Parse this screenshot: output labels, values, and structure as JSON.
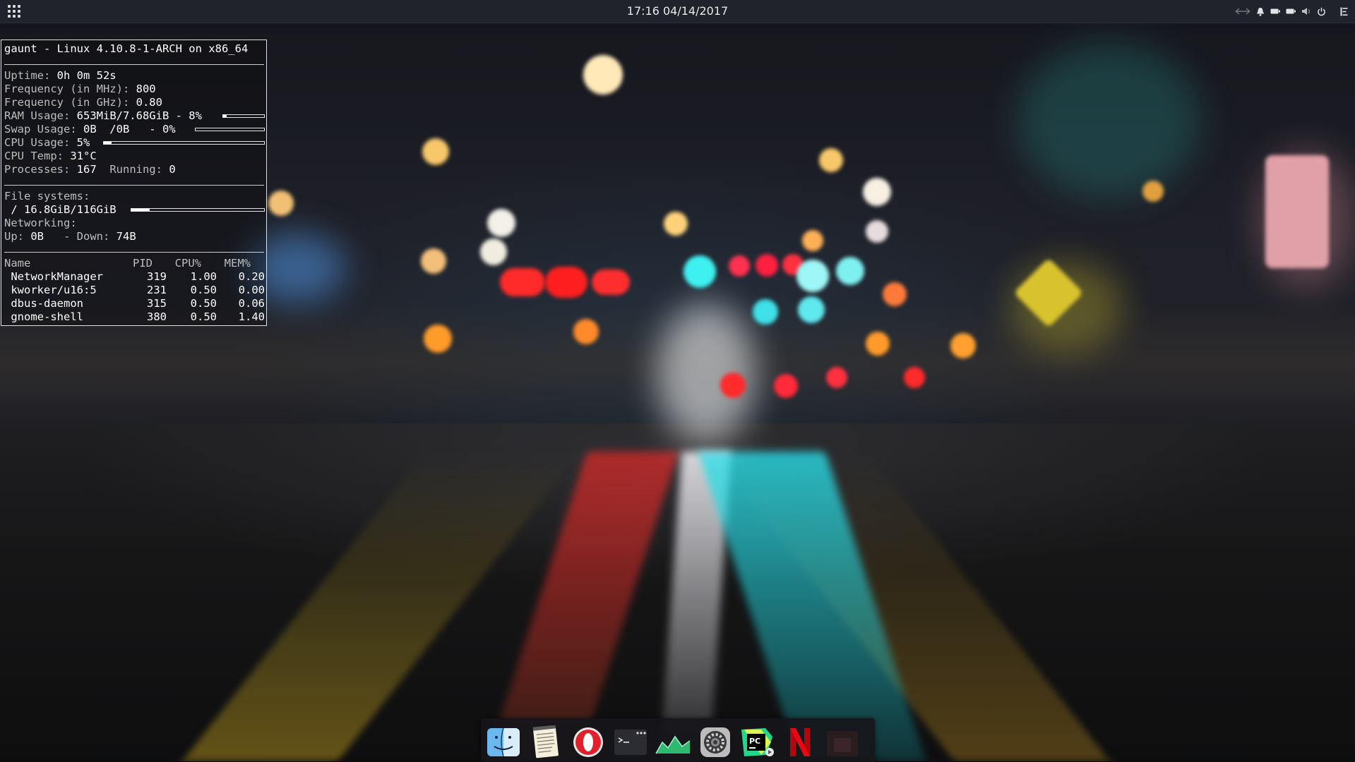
{
  "top_panel": {
    "apps_icon": "app-grid-icon",
    "clock": "17:16  04/14/2017",
    "tray_icons": [
      "network-icon",
      "notification-bell-icon",
      "battery-icon",
      "battery-icon",
      "volume-icon",
      "power-icon",
      "menu-icon"
    ]
  },
  "conky": {
    "title": "gaunt - Linux 4.10.8-1-ARCH on x86_64",
    "uptime_label": "Uptime: ",
    "uptime": "0h 0m 52s",
    "freq_mhz_label": "Frequency (in MHz): ",
    "freq_mhz": "800",
    "freq_ghz_label": "Frequency (in GHz): ",
    "freq_ghz": "0.80",
    "ram_label": "RAM Usage: ",
    "ram": "653MiB/7.68GiB - 8%",
    "ram_fraction": 0.08,
    "swap_label": "Swap Usage: ",
    "swap": "0B  /0B   - 0%",
    "swap_fraction": 0.0,
    "cpu_label": "CPU Usage: ",
    "cpu": "5%",
    "cpu_fraction": 0.05,
    "temp_label": "CPU Temp: ",
    "temp": "31°C",
    "processes_label": "Processes: ",
    "processes": "167",
    "running_label": "  Running: ",
    "running": "0",
    "fs_label": "File systems:",
    "fs_root": " / 16.8GiB/116GiB",
    "fs_fraction": 0.14,
    "net_label": "Networking:",
    "up_label": "Up: ",
    "up": "0B",
    "down_label": "   - Down: ",
    "down": "74B",
    "proc_headers": [
      "Name",
      "PID",
      "CPU%",
      "MEM%"
    ],
    "procs": [
      {
        "name": " NetworkManager",
        "pid": "319",
        "cpu": "1.00",
        "mem": "0.20"
      },
      {
        "name": " kworker/u16:5",
        "pid": "231",
        "cpu": "0.50",
        "mem": "0.00"
      },
      {
        "name": " dbus-daemon",
        "pid": "315",
        "cpu": "0.50",
        "mem": "0.06"
      },
      {
        "name": " gnome-shell",
        "pid": "380",
        "cpu": "0.50",
        "mem": "1.40"
      }
    ]
  },
  "dock": {
    "items": [
      {
        "name": "finder-icon"
      },
      {
        "name": "text-editor-icon"
      },
      {
        "name": "opera-browser-icon"
      },
      {
        "name": "terminal-icon"
      },
      {
        "name": "system-monitor-icon"
      },
      {
        "name": "settings-gear-icon"
      },
      {
        "name": "pycharm-icon"
      },
      {
        "name": "netflix-icon"
      },
      {
        "name": "blank-app-icon"
      }
    ]
  }
}
